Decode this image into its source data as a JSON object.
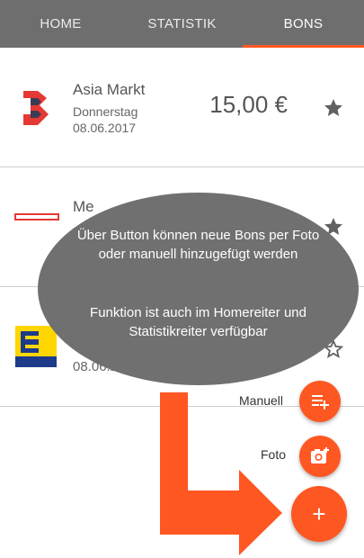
{
  "tabs": [
    "HOME",
    "STATISTIK",
    "BONS"
  ],
  "receipts": [
    {
      "store": "Asia Markt",
      "day": "Donnerstag",
      "date": "08.06.2017",
      "amount": "15,00 €",
      "favorite": true
    },
    {
      "store": "Me",
      "favorite": true
    },
    {
      "date": "08.06.2",
      "favorite": false
    }
  ],
  "tooltip": {
    "line1": "Über Button können neue Bons per Foto oder manuell hinzugefügt werden",
    "line2": "Funktion ist auch im Homereiter und Statistikreiter verfügbar"
  },
  "fab": {
    "manual_label": "Manuell",
    "photo_label": "Foto",
    "add_symbol": "+"
  },
  "colors": {
    "accent": "#ff5722",
    "tabbar": "#6e6e6e",
    "overlay": "#707070"
  }
}
